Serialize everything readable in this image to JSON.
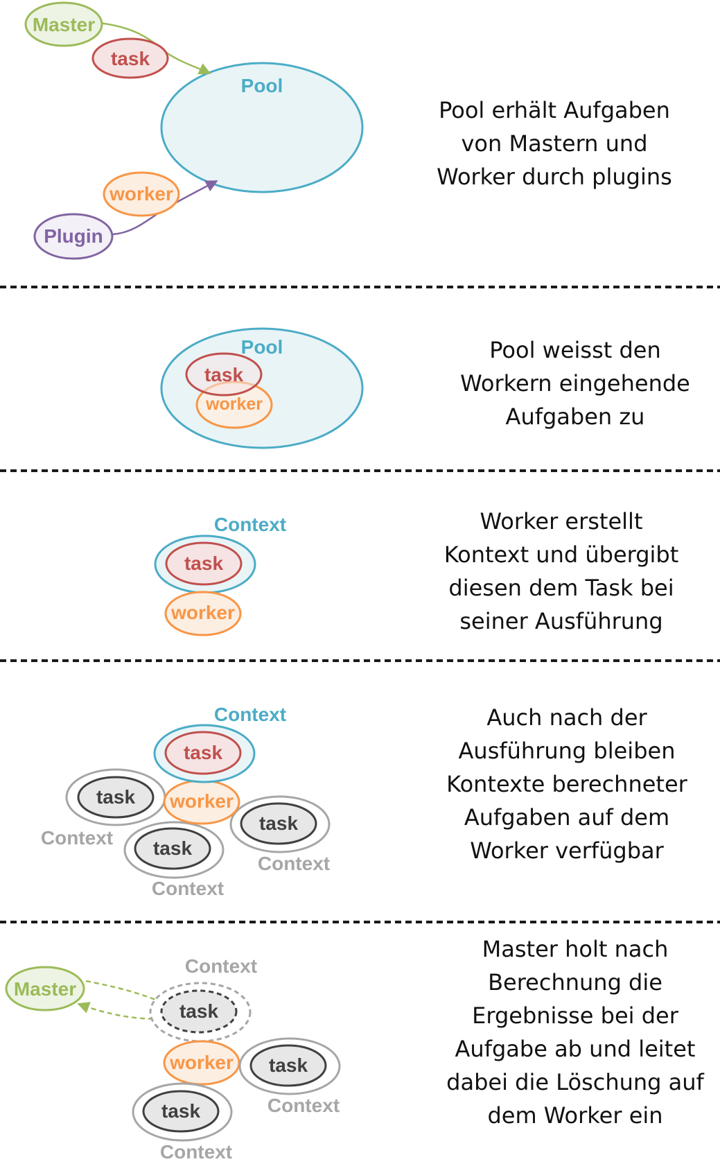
{
  "colors": {
    "master": "#9bbb59",
    "master_fill": "#eef4e4",
    "task": "#c0504d",
    "task_fill": "#f6e4e4",
    "pool": "#4bacc6",
    "pool_fill": "#e9f4f7",
    "worker": "#f79646",
    "worker_fill": "#fdeee2",
    "plugin": "#8064a2",
    "plugin_fill": "#f3f0f7",
    "old_task": "#404040",
    "old_task_fill": "#e7e7e7",
    "old_context": "#a6a6a6",
    "separator": "#1a1a1a"
  },
  "labels": {
    "master": "Master",
    "task": "task",
    "pool": "Pool",
    "worker": "worker",
    "plugin": "Plugin",
    "context": "Context"
  },
  "steps": [
    {
      "lines": [
        "Pool erhält Aufgaben",
        "von Mastern und",
        "Worker durch plugins"
      ]
    },
    {
      "lines": [
        "Pool weisst den",
        "Workern eingehende",
        "Aufgaben zu"
      ]
    },
    {
      "lines": [
        "Worker erstellt",
        "Kontext und übergibt",
        "diesen dem Task bei",
        "seiner Ausführung"
      ]
    },
    {
      "lines": [
        "Auch nach der",
        "Ausführung bleiben",
        "Kontexte berechneter",
        "Aufgaben auf dem",
        "Worker verfügbar"
      ]
    },
    {
      "lines": [
        "Master holt nach",
        "Berechnung die",
        "Ergebnisse bei der",
        "Aufgabe ab und leitet",
        "dabei die Löschung auf",
        "dem Worker ein"
      ]
    }
  ]
}
